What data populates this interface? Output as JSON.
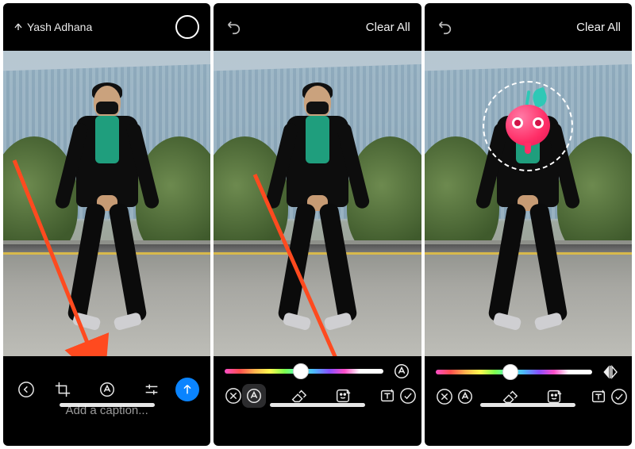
{
  "panel1": {
    "username": "Yash Adhana",
    "caption_placeholder": "Add a caption...",
    "icons": {
      "back": "back-chevron",
      "crop": "crop",
      "markup": "markup",
      "adjust": "adjust",
      "send": "send"
    }
  },
  "panel2": {
    "clear_all": "Clear All",
    "slider": {
      "thumb_pct": 48
    },
    "icons": {
      "undo": "undo",
      "pen": "pen",
      "close": "close",
      "markup": "markup",
      "eraser": "eraser",
      "sticker": "sticker",
      "text": "text",
      "confirm": "confirm"
    }
  },
  "panel3": {
    "clear_all": "Clear All",
    "slider": {
      "thumb_pct": 48
    },
    "sticker": {
      "name": "cherry-face"
    },
    "icons": {
      "undo": "undo",
      "mirror": "mirror",
      "close": "close",
      "markup": "markup",
      "eraser": "eraser",
      "sticker": "sticker",
      "text": "text",
      "confirm": "confirm"
    }
  },
  "arrows": {
    "color": "#ff4a1f"
  }
}
